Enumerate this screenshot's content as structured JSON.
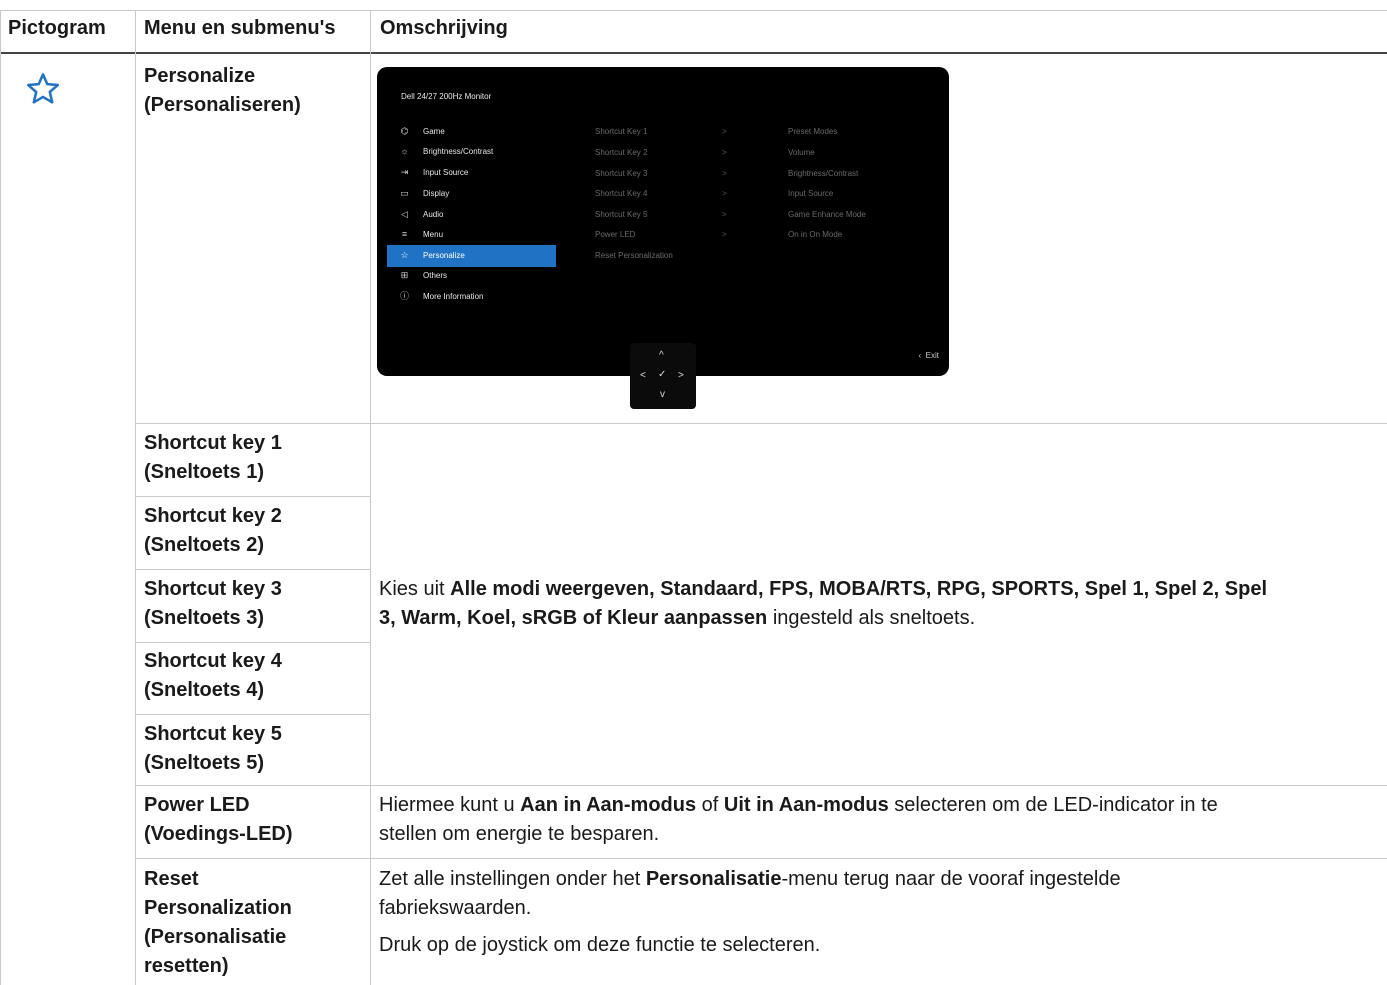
{
  "header": {
    "col1": "Pictogram",
    "col2": "Menu en submenu's",
    "col3": "Omschrijving"
  },
  "icon": "star-outline-icon",
  "accent_color": "#1f72c4",
  "rows": {
    "personalize": {
      "en": "Personalize",
      "nl": "(Personaliseren)"
    },
    "sk1": {
      "en": "Shortcut key 1",
      "nl": "(Sneltoets 1)"
    },
    "sk2": {
      "en": "Shortcut key 2",
      "nl": "(Sneltoets 2)"
    },
    "sk3": {
      "en": "Shortcut key 3",
      "nl": "(Sneltoets 3)"
    },
    "sk4": {
      "en": "Shortcut key 4",
      "nl": "(Sneltoets 4)"
    },
    "sk5": {
      "en": "Shortcut key 5",
      "nl": "(Sneltoets 5)"
    },
    "power": {
      "en": "Power LED",
      "nl": "(Voedings-LED)"
    },
    "reset": {
      "l1": "Reset",
      "l2": "Personalization",
      "l3": "(Personalisatie",
      "l4": "resetten)"
    }
  },
  "desc": {
    "shortcut_pre": "Kies uit ",
    "shortcut_bold1": "Alle modi weergeven, Standaard, FPS, MOBA/RTS, RPG, SPORTS, Spel 1, Spel 2, Spel",
    "shortcut_bold2": "3, Warm, Koel, sRGB of Kleur aanpassen",
    "shortcut_post": " ingesteld als sneltoets.",
    "power_pre": "Hiermee kunt u ",
    "power_b1": "Aan in Aan-modus",
    "power_mid": " of ",
    "power_b2": "Uit in Aan-modus",
    "power_post1": " selecteren om de LED-indicator in te",
    "power_line2": "stellen om energie te besparen.",
    "reset_pre": "Zet alle instellingen onder het ",
    "reset_b": "Personalisatie",
    "reset_post1": "-menu terug naar de vooraf ingestelde",
    "reset_line2": "fabriekswaarden.",
    "reset_line3": "Druk op de joystick om deze functie te selecteren."
  },
  "osd": {
    "title": "Dell 24/27 200Hz Monitor",
    "menu": [
      {
        "icon": "gamepad-icon",
        "glyph": "⌬",
        "label": "Game"
      },
      {
        "icon": "brightness-icon",
        "glyph": "☼",
        "label": "Brightness/Contrast"
      },
      {
        "icon": "input-source-icon",
        "glyph": "⇥",
        "label": "Input Source"
      },
      {
        "icon": "display-icon",
        "glyph": "▭",
        "label": "Display"
      },
      {
        "icon": "audio-icon",
        "glyph": "◁",
        "label": "Audio"
      },
      {
        "icon": "menu-icon",
        "glyph": "≡",
        "label": "Menu"
      },
      {
        "icon": "star-icon",
        "glyph": "☆",
        "label": "Personalize"
      },
      {
        "icon": "others-icon",
        "glyph": "⊞",
        "label": "Others"
      },
      {
        "icon": "info-icon",
        "glyph": "ⓘ",
        "label": "More Information"
      }
    ],
    "selected_index": 6,
    "submenu": [
      "Shortcut Key 1",
      "Shortcut Key 2",
      "Shortcut Key 3",
      "Shortcut Key 4",
      "Shortcut Key 5",
      "Power LED",
      "Reset Personalization"
    ],
    "values": [
      "Preset Modes",
      "Volume",
      "Brightness/Contrast",
      "Input Source",
      "Game Enhance Mode",
      "On in On Mode"
    ],
    "arrow": ">",
    "exit": "Exit",
    "joystick": {
      "up": "^",
      "down": "v",
      "left": "<",
      "right": ">",
      "ok": "✓"
    }
  }
}
